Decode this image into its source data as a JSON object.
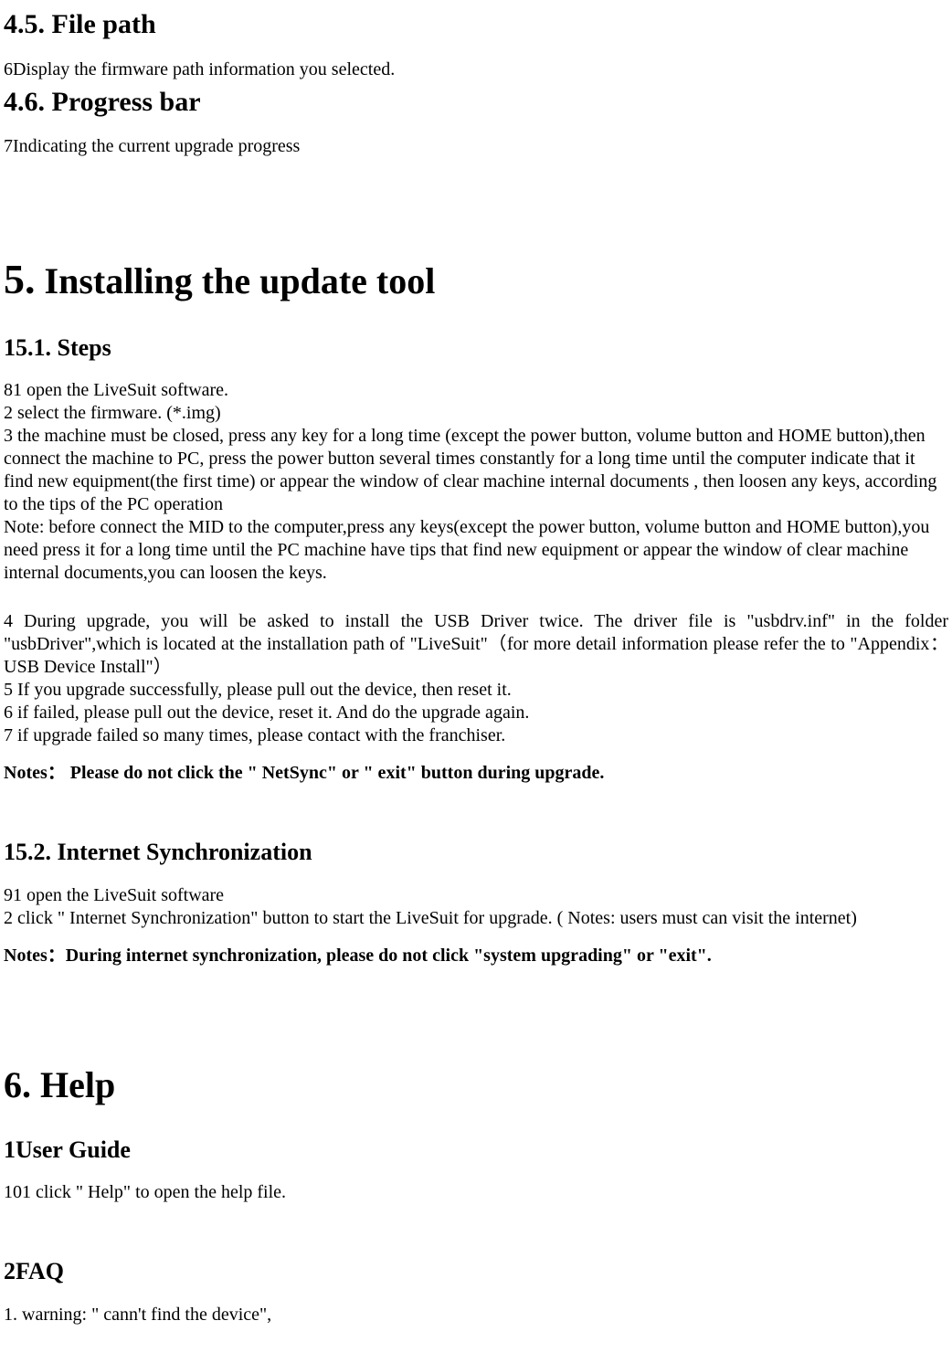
{
  "sections": {
    "filePath": {
      "heading": "4.5. File path",
      "body": "6Display the firmware path information you selected."
    },
    "progressBar": {
      "heading": "4.6. Progress bar",
      "body": "7Indicating the current upgrade progress"
    },
    "install": {
      "majorPrefix": "5.",
      "majorRest": " Installing the update tool",
      "steps": {
        "heading": "15.1. Steps",
        "line1": "81 open the LiveSuit software.",
        "line2": "2 select the firmware. (*.img)",
        "line3": "3 the machine must be closed, press any key for a long time (except the power button, volume   button and HOME button),then connect the machine to PC, press the power button several times constantly for a long time until the computer indicate that it find new equipment(the first time) or appear the window of clear machine internal documents , then loosen any keys, according to the tips of   the PC operation",
        "note": "Note: before connect the MID to the computer,press any keys(except the power button, volume button and HOME button),you need press it for a long time until the PC machine have tips that find new equipment or appear the window of clear machine internal documents,you can loosen the keys.",
        "line4": "4 During upgrade, you will be asked to install the USB Driver twice. The driver file is \"usbdrv.inf\" in the folder \"usbDriver\",which is located at the installation path of \"LiveSuit\"（for more detail information please refer the to \"Appendix：USB Device Install\"）",
        "line5": "5 If you upgrade successfully, please pull out the device, then reset it.",
        "line6": "6 if failed, please pull out the device, reset it. And do the upgrade again.",
        "line7": "7 if upgrade failed so many times, please contact with the franchiser.",
        "notes": "Notes：  Please do not click the \" NetSync\" or \" exit\" button during upgrade."
      },
      "internetSync": {
        "heading": "15.2. Internet Synchronization",
        "line1": "91 open the LiveSuit software",
        "line2": "2 click \" Internet Synchronization\" button to start the LiveSuit for upgrade. ( Notes: users must can visit the internet)",
        "notes": "Notes：During internet synchronization, please do not click \"system upgrading\" or \"exit\"."
      }
    },
    "help": {
      "major": "6. Help",
      "userGuide": {
        "heading": "1User Guide",
        "line1": "101 click \" Help\" to open the help file."
      },
      "faq": {
        "heading": "2FAQ",
        "line1": "1. warning: \" cann't find the device\","
      }
    }
  }
}
